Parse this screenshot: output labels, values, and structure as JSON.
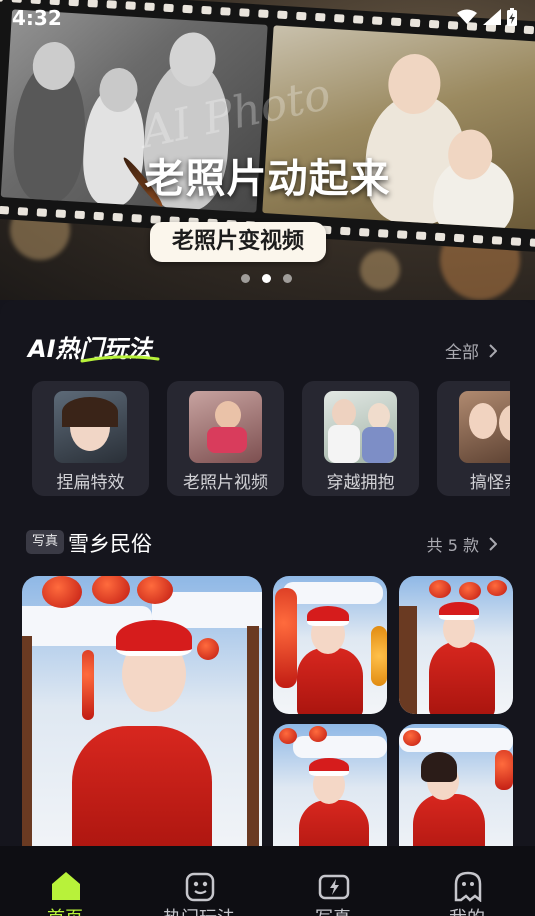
{
  "status_bar": {
    "time": "4:32"
  },
  "banner": {
    "watermark": "AI Photo",
    "title": "老照片动起来",
    "subtitle": "老照片变视频",
    "dots": 3,
    "active_dot": 1
  },
  "ai_section": {
    "title": "AI热门玩法",
    "see_all": "全部",
    "cards": [
      {
        "label": "捏扁特效"
      },
      {
        "label": "老照片视频"
      },
      {
        "label": "穿越拥抱"
      },
      {
        "label": "搞怪亲"
      }
    ]
  },
  "xiang_section": {
    "tag": "写真",
    "title": "雪乡民俗",
    "count": "共 5 款"
  },
  "nav": {
    "items": [
      {
        "label": "首页",
        "active": true
      },
      {
        "label": "热门玩法",
        "active": false
      },
      {
        "label": "写真",
        "active": false
      },
      {
        "label": "我的",
        "active": false
      }
    ]
  },
  "colors": {
    "accent": "#b8f23a",
    "background": "#15151d",
    "card": "#272731"
  }
}
